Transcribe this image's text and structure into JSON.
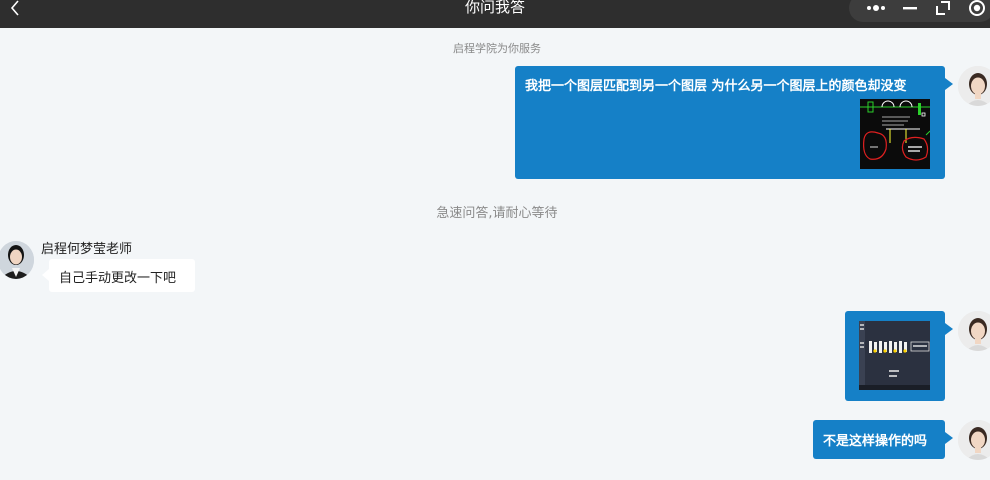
{
  "window": {
    "title": "你问我答"
  },
  "titlebar": {
    "back_icon": "chevron-left-icon",
    "capsule_icons": [
      "more-icon",
      "minimize-icon",
      "restore-icon",
      "record-icon"
    ]
  },
  "notices": {
    "service": "启程学院为你服务",
    "waiting": "急速问答,请耐心等待"
  },
  "messages": {
    "m1": {
      "text": "我把一个图层匹配到另一个图层 为什么另一个图层上的颜色却没变"
    },
    "m2": {
      "teacher_name": "启程何梦莹老师",
      "text": "自己手动更改一下吧"
    },
    "m4": {
      "text": "不是这样操作的吗"
    }
  },
  "colors": {
    "bubble_blue": "#1580c7",
    "titlebar": "#2e2e2e",
    "background": "#f3f6f8"
  }
}
